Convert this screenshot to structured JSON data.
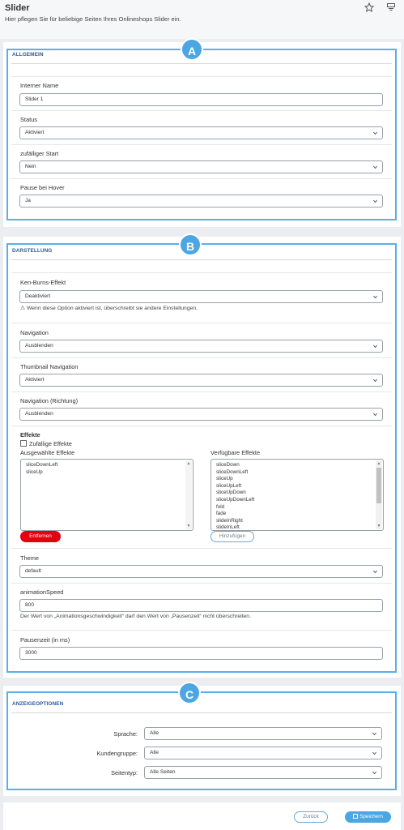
{
  "header": {
    "title": "Slider",
    "subtitle": "Hier pflegen Sie für beliebige Seiten Ihres Onlineshops Slider ein.",
    "icons": [
      "star-icon",
      "layout-icon"
    ]
  },
  "badges": {
    "a": "A",
    "b": "B",
    "c": "C"
  },
  "allgemein": {
    "title": "ALLGEMEIN",
    "internal_name_label": "Interner Name",
    "internal_name_value": "Slider 1",
    "status_label": "Status",
    "status_value": "Aktiviert",
    "random_start_label": "zufälliger Start",
    "random_start_value": "Nein",
    "pause_hover_label": "Pause bei Hover",
    "pause_hover_value": "Ja"
  },
  "darstellung": {
    "title": "DARSTELLUNG",
    "ken_burns_label": "Ken-Burns-Effekt",
    "ken_burns_value": "Deaktiviert",
    "ken_burns_hint": "⚠ Wenn diese Option aktiviert ist, überschreibt sie andere Einstellungen.",
    "navigation_label": "Navigation",
    "navigation_value": "Ausblenden",
    "thumb_nav_label": "Thumbnail Navigation",
    "thumb_nav_value": "Aktiviert",
    "nav_dir_label": "Navigation (Richtung)",
    "nav_dir_value": "Ausblenden",
    "effects_heading": "Effekte",
    "random_effects_label": "Zufällige Effekte",
    "selected_effects_label": "Ausgewählte Effekte",
    "selected_effects": [
      "sliceDownLeft",
      "sliceUp"
    ],
    "available_effects_label": "Verfügbare Effekte",
    "available_effects": [
      "sliceDown",
      "sliceDownLeft",
      "sliceUp",
      "sliceUpLeft",
      "sliceUpDown",
      "sliceUpDownLeft",
      "fold",
      "fade",
      "slideInRight",
      "slideInLeft"
    ],
    "remove_button": "Entfernen",
    "add_button": "Hinzufügen",
    "theme_label": "Theme",
    "theme_value": "default",
    "anim_speed_label": "animationSpeed",
    "anim_speed_value": "800",
    "anim_speed_hint": "Der Wert von „Animationsgeschwindigkeit“ darf den Wert von „Pausenzeit“ nicht überschreiten.",
    "pause_time_label": "Pausenzeit (in ms)",
    "pause_time_value": "3000"
  },
  "anzeige": {
    "title": "ANZEIGEOPTIONEN",
    "language_label": "Sprache:",
    "language_value": "Alle",
    "customer_group_label": "Kundengruppe:",
    "customer_group_value": "Alle",
    "page_type_label": "Seitentyp:",
    "page_type_value": "Alle Seiten"
  },
  "footer": {
    "back_button": "Zurück",
    "save_button": "Speichern",
    "save_icon": "save-icon"
  },
  "colors": {
    "highlight": "#5aafe6",
    "badge": "#4ba6e2",
    "section_title": "#2b5a9b",
    "danger": "#e3000f"
  }
}
